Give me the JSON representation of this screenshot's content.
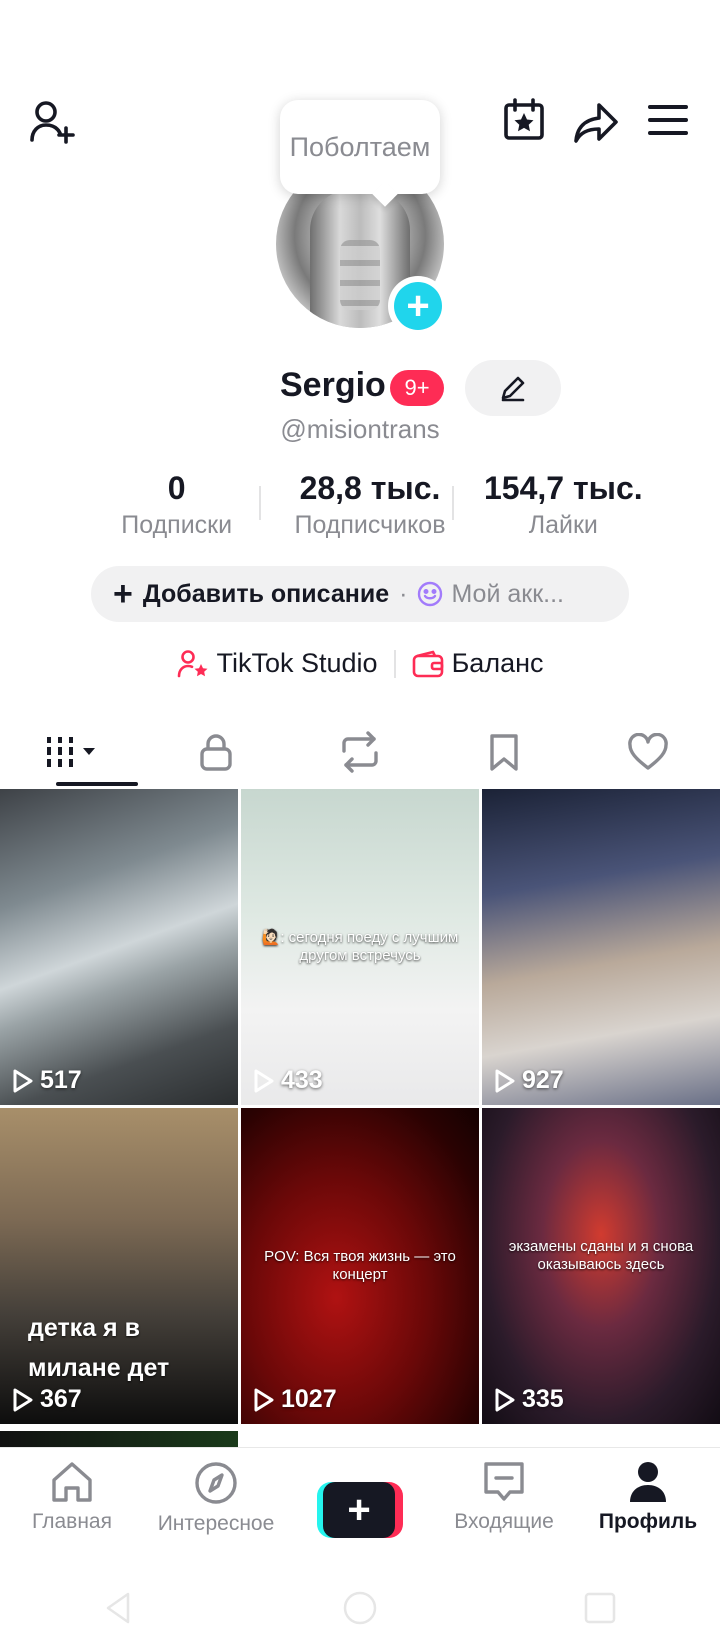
{
  "header": {
    "add_friend_icon": "person-plus-icon",
    "calendar_icon": "calendar-star-icon",
    "share_icon": "share-arrow-icon",
    "menu_icon": "hamburger-menu-icon"
  },
  "tooltip": {
    "text": "Поболтаем"
  },
  "profile": {
    "name": "Sergio",
    "badge": "9+",
    "handle": "@misiontrans",
    "edit_icon": "pencil-icon"
  },
  "stats": [
    {
      "value": "0",
      "label": "Подписки"
    },
    {
      "value": "28,8 тыс.",
      "label": "Подписчиков"
    },
    {
      "value": "154,7 тыс.",
      "label": "Лайки"
    }
  ],
  "description": {
    "add_label": "Добавить описание",
    "separator": "·",
    "account_label": "Мой акк..."
  },
  "links": {
    "studio": "TikTok Studio",
    "balance": "Баланс"
  },
  "tabs": [
    "videos",
    "private",
    "reposts",
    "favorites",
    "liked"
  ],
  "videos": [
    {
      "views": "517",
      "caption": ""
    },
    {
      "views": "433",
      "caption": "🙋🏻: сегодня поеду с лучшим другом встречусь"
    },
    {
      "views": "927",
      "caption": ""
    },
    {
      "views": "367",
      "caption": "детка я в милане дет"
    },
    {
      "views": "1027",
      "caption": "POV: Вся твоя жизнь — это концерт"
    },
    {
      "views": "335",
      "caption": "экзамены сданы и я снова оказываюсь здесь"
    }
  ],
  "bottom_nav": {
    "home": "Главная",
    "explore": "Интересное",
    "inbox": "Входящие",
    "profile": "Профиль"
  },
  "colors": {
    "accent": "#fe2c55",
    "cyan": "#20d5ec",
    "text": "#161823",
    "muted": "#8a8b91"
  }
}
